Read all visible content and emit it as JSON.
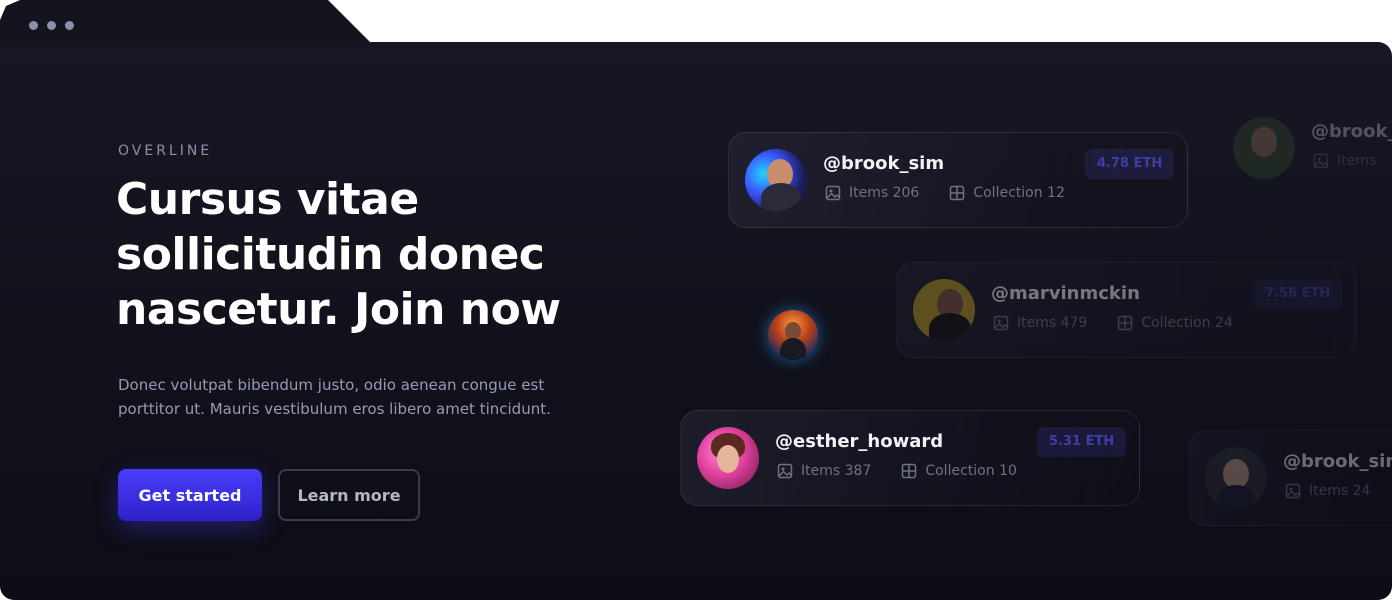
{
  "hero": {
    "overline": "OVERLINE",
    "headline_line1": "Cursus vitae",
    "headline_line2": "sollicitudin donec",
    "headline_line3": "nascetur. Join now",
    "lead_line1": "Donec volutpat bibendum justo, odio aenean congue est",
    "lead_line2": "porttitor ut. Mauris vestibulum eros libero amet tincidunt.",
    "primary_button": "Get started",
    "secondary_button": "Learn more"
  },
  "cards": [
    {
      "handle": "@brook_sim",
      "items": "Items 206",
      "collection": "Collection 12",
      "price": "4.78 ETH"
    },
    {
      "handle": "@marvinmckin",
      "items": "Items 479",
      "collection": "Collection 24",
      "price": "7.56 ETH"
    },
    {
      "handle": "@esther_howard",
      "items": "Items 387",
      "collection": "Collection 10",
      "price": "5.31 ETH"
    },
    {
      "handle": "@brook_",
      "items": "Items"
    },
    {
      "handle": "@brook_sim",
      "items": "Items 24"
    }
  ],
  "colors": {
    "background": "#12121c",
    "accent": "#3f32e6",
    "text_primary": "#ffffff",
    "text_muted": "#9799b5"
  },
  "icons": {
    "window_controls": "three-dots-icon",
    "items": "image-icon",
    "collection": "grid-icon"
  }
}
